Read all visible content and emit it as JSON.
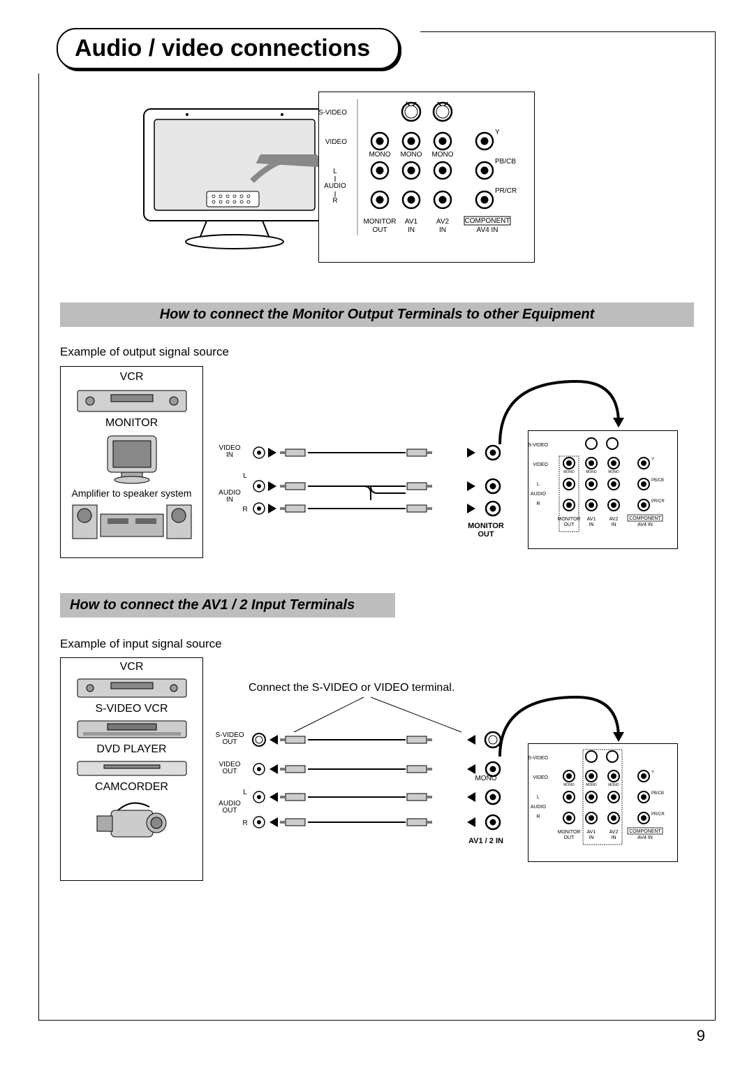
{
  "title": "Audio / video connections",
  "subheading1": "How to connect the Monitor Output Terminals to other Equipment",
  "subheading2": "How to connect the AV1 / 2 Input Terminals",
  "example1": "Example of output signal source",
  "example2": "Example of input signal source",
  "src1": {
    "vcr": "VCR",
    "monitor": "MONITOR",
    "amp": "Amplifier to speaker system"
  },
  "src2": {
    "vcr": "VCR",
    "svcr": "S-VIDEO VCR",
    "dvd": "DVD PLAYER",
    "cam": "CAMCORDER"
  },
  "panel": {
    "svideo": "S-VIDEO",
    "video": "VIDEO",
    "audio": "AUDIO",
    "l": "L",
    "r": "R",
    "mono": "MONO",
    "y": "Y",
    "pb": "PB/CB",
    "pr": "PR/CR",
    "cols": {
      "monout": "MONITOR\nOUT",
      "av1": "AV1\nIN",
      "av2": "AV2\nIN",
      "comp": "COMPONENT",
      "av4": "AV4 IN"
    }
  },
  "cables_out": {
    "video_in": "VIDEO\nIN",
    "audio_in": "AUDIO\nIN",
    "l": "L",
    "r": "R",
    "dest_bold": "MONITOR\nOUT"
  },
  "cables_in": {
    "svideo_out": "S-VIDEO\nOUT",
    "video_out": "VIDEO\nOUT",
    "audio_out": "AUDIO\nOUT",
    "l": "L",
    "r": "R",
    "mono": "MONO",
    "dest_bold": "AV1 / 2 IN"
  },
  "note_in": "Connect the S-VIDEO or VIDEO terminal.",
  "page_number": "9"
}
